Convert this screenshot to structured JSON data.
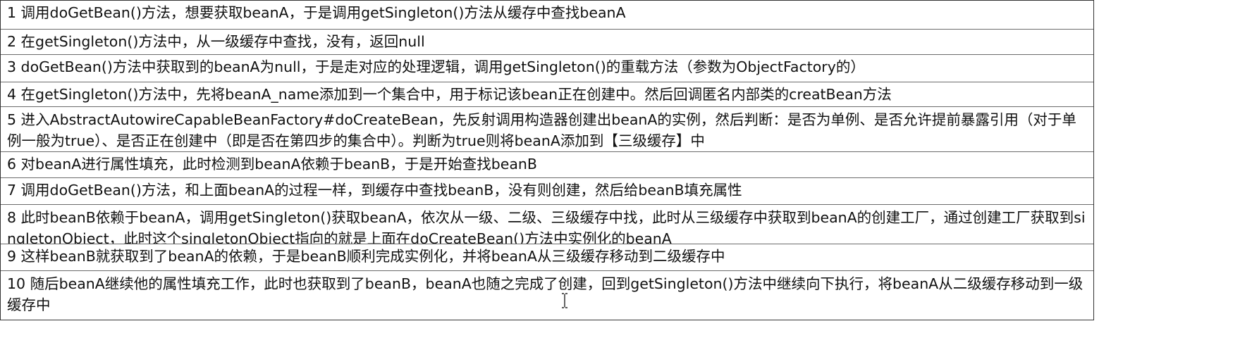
{
  "steps": [
    {
      "text": "1 调用doGetBean()方法，想要获取beanA，于是调用getSingleton()方法从缓存中查找beanA"
    },
    {
      "text": "2 在getSingleton()方法中，从一级缓存中查找，没有，返回null"
    },
    {
      "text": "3 doGetBean()方法中获取到的beanA为null，于是走对应的处理逻辑，调用getSingleton()的重载方法（参数为ObjectFactory的）"
    },
    {
      "text": "4 在getSingleton()方法中，先将beanA_name添加到一个集合中，用于标记该bean正在创建中。然后回调匿名内部类的creatBean方法"
    },
    {
      "text": "5 进入AbstractAutowireCapableBeanFactory#doCreateBean，先反射调用构造器创建出beanA的实例，然后判断：是否为单例、是否允许提前暴露引用（对于单例一般为true）、是否正在创建中（即是否在第四步的集合中）。判断为true则将beanA添加到【三级缓存】中"
    },
    {
      "text": "6 对beanA进行属性填充，此时检测到beanA依赖于beanB，于是开始查找beanB"
    },
    {
      "text": "7 调用doGetBean()方法，和上面beanA的过程一样，到缓存中查找beanB，没有则创建，然后给beanB填充属性"
    },
    {
      "text": "8 此时beanB依赖于beanA，调用getSingleton()获取beanA，依次从一级、二级、三级缓存中找，此时从三级缓存中获取到beanA的创建工厂，通过创建工厂获取到singletonObject，此时这个singletonObject指向的就是上面在doCreateBean()方法中实例化的beanA"
    },
    {
      "text": "9 这样beanB就获取到了beanA的依赖，于是beanB顺利完成实例化，并将beanA从三级缓存移动到二级缓存中"
    },
    {
      "text": "10 随后beanA继续他的属性填充工作，此时也获取到了beanB，beanA也随之完成了创建，回到getSingleton()方法中继续向下执行，将beanA从二级缓存移动到一级缓存中"
    }
  ],
  "cursor_icon": "text-ibeam-cursor"
}
